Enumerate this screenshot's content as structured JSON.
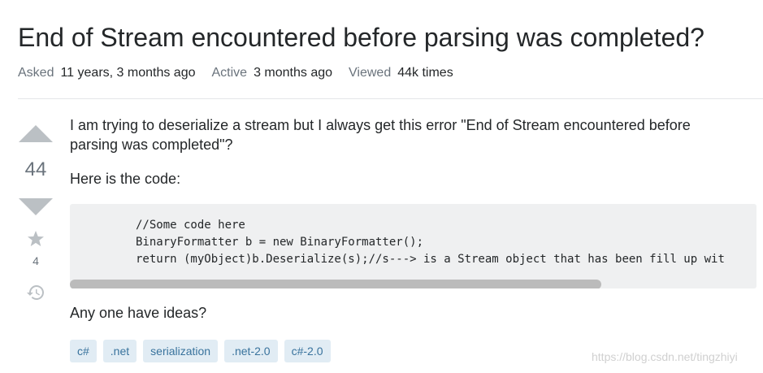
{
  "question": {
    "title": "End of Stream encountered before parsing was completed?",
    "meta": [
      {
        "label": "Asked",
        "value": "11 years, 3 months ago"
      },
      {
        "label": "Active",
        "value": "3 months ago"
      },
      {
        "label": "Viewed",
        "value": "44k times"
      }
    ],
    "votes": "44",
    "favorites": "4",
    "body": {
      "p1": "I am trying to deserialize a stream but I always get this error \"End of Stream encountered before parsing was completed\"?",
      "p2": "Here is the code:",
      "code": "//Some code here\nBinaryFormatter b = new BinaryFormatter();\nreturn (myObject)b.Deserialize(s);//s---> is a Stream object that has been fill up wit",
      "p3": "Any one have ideas?"
    },
    "tags": [
      "c#",
      ".net",
      "serialization",
      ".net-2.0",
      "c#-2.0"
    ]
  },
  "watermark": "https://blog.csdn.net/tingzhiyi",
  "colors": {
    "tag_bg": "#e1ecf4",
    "tag_text": "#39739d",
    "vote_arrow": "#bbc0c4",
    "code_bg": "#eff0f1"
  },
  "icons": [
    "vote-up-icon",
    "vote-down-icon",
    "star-icon",
    "history-icon"
  ]
}
